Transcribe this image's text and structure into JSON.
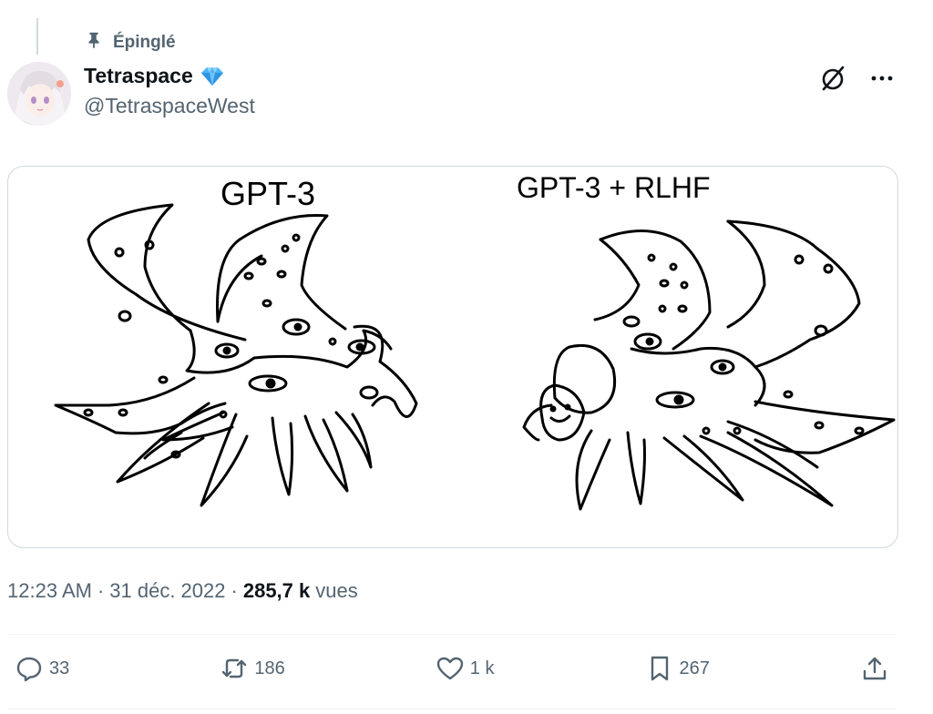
{
  "pinned": {
    "label": "Épinglé",
    "icon": "pin-icon"
  },
  "author": {
    "name": "Tetraspace",
    "handle": "@TetraspaceWest",
    "badge_icon": "diamond-verified-icon",
    "avatar": "avatar"
  },
  "top_actions": [
    {
      "name": "grok-icon"
    },
    {
      "name": "more-options-icon"
    }
  ],
  "media": {
    "panels": [
      {
        "caption": "GPT-3"
      },
      {
        "caption": "GPT-3 + RLHF"
      }
    ]
  },
  "meta": {
    "time": "12:23 AM",
    "date": "31 déc. 2022",
    "views": "285,7 k",
    "views_label": "vues",
    "separator": "·"
  },
  "actions": {
    "replies": "33",
    "reposts": "186",
    "likes": "1 k",
    "bookmarks": "267"
  },
  "colors": {
    "text_primary": "#0f1419",
    "text_secondary": "#536471",
    "border": "#cfd9de",
    "badge": "#4fb3f6"
  }
}
